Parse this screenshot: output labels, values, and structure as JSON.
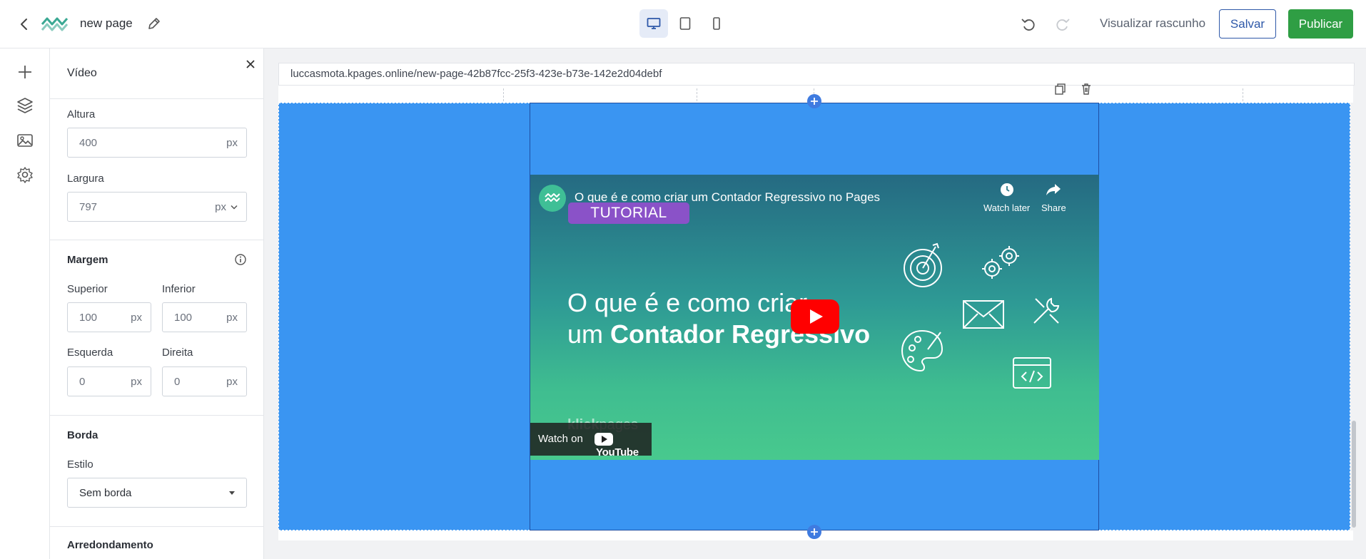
{
  "header": {
    "page_name": "new page",
    "preview_label": "Visualizar rascunho",
    "save_label": "Salvar",
    "publish_label": "Publicar"
  },
  "colors": {
    "accent": "#2e58a8",
    "publish": "#2f9e44",
    "section_bg": "#3a95f2"
  },
  "panel": {
    "title": "Vídeo",
    "altura": {
      "label": "Altura",
      "value": "400",
      "unit": "px"
    },
    "largura": {
      "label": "Largura",
      "value": "797",
      "unit": "px"
    },
    "margem": {
      "title": "Margem",
      "superior": {
        "label": "Superior",
        "value": "100",
        "unit": "px"
      },
      "inferior": {
        "label": "Inferior",
        "value": "100",
        "unit": "px"
      },
      "esquerda": {
        "label": "Esquerda",
        "value": "0",
        "unit": "px"
      },
      "direita": {
        "label": "Direita",
        "value": "0",
        "unit": "px"
      }
    },
    "borda": {
      "title": "Borda",
      "estilo_label": "Estilo",
      "estilo_value": "Sem borda"
    },
    "arredondamento_title": "Arredondamento"
  },
  "canvas": {
    "url": "luccasmota.kpages.online/new-page-42b87fcc-25f3-423e-b73e-142e2d04debf"
  },
  "video": {
    "title": "O que é e como criar um Contador Regressivo no Pages",
    "watch_later": "Watch later",
    "share": "Share",
    "badge": "TUTORIAL",
    "headline_line1": "O que é e como criar",
    "headline_line2_prefix": "um ",
    "headline_line2_bold": "Contador Regressivo",
    "brand_bold": "klick",
    "brand_rest": "pages",
    "watch_on": "Watch on",
    "youtube_word": "YouTube"
  }
}
